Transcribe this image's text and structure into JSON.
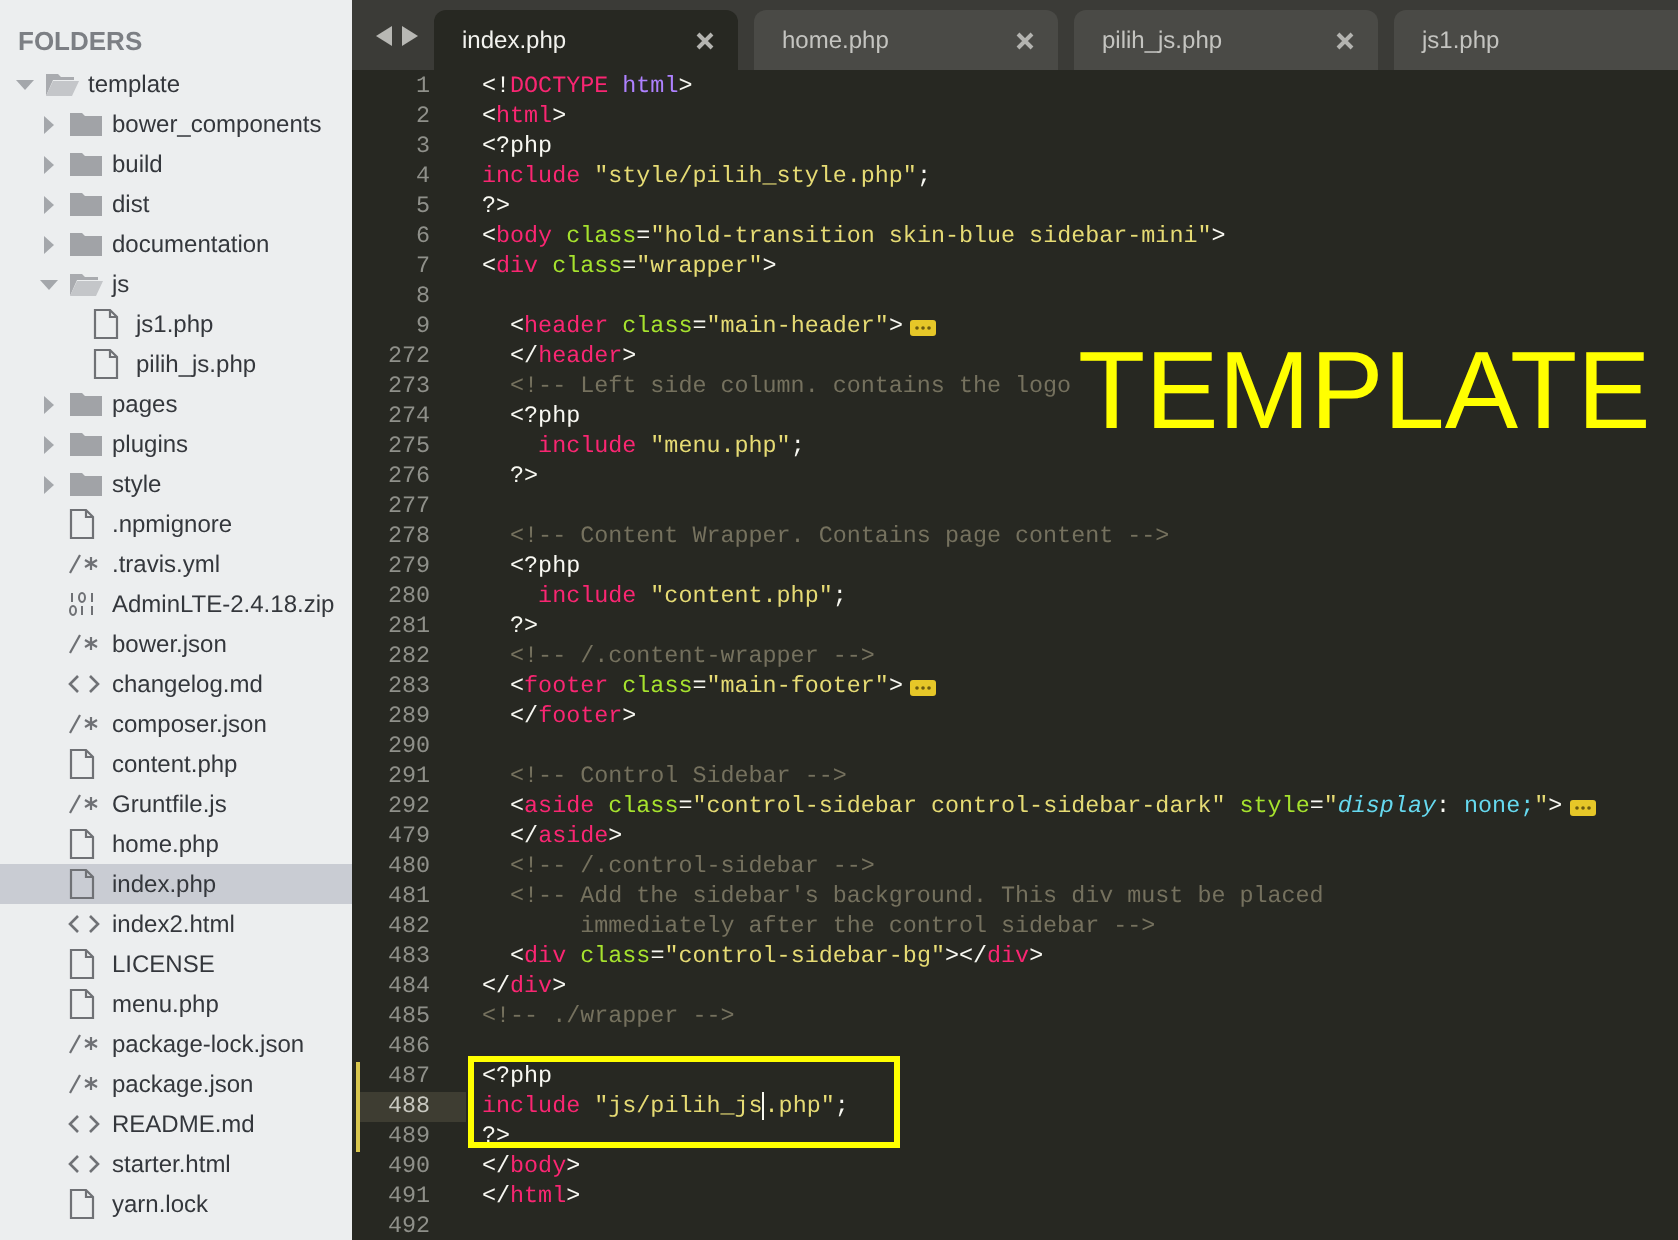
{
  "sidebar": {
    "title": "FOLDERS",
    "items": [
      {
        "name": "template",
        "kind": "folder",
        "expanded": true,
        "selected": false,
        "children": [
          {
            "name": "bower_components",
            "kind": "folder",
            "expanded": false,
            "selected": false
          },
          {
            "name": "build",
            "kind": "folder",
            "expanded": false,
            "selected": false
          },
          {
            "name": "dist",
            "kind": "folder",
            "expanded": false,
            "selected": false
          },
          {
            "name": "documentation",
            "kind": "folder",
            "expanded": false,
            "selected": false
          },
          {
            "name": "js",
            "kind": "folder",
            "expanded": true,
            "selected": false,
            "children": [
              {
                "name": "js1.php",
                "kind": "file",
                "selected": false
              },
              {
                "name": "pilih_js.php",
                "kind": "file",
                "selected": false
              }
            ]
          },
          {
            "name": "pages",
            "kind": "folder",
            "expanded": false,
            "selected": false
          },
          {
            "name": "plugins",
            "kind": "folder",
            "expanded": false,
            "selected": false
          },
          {
            "name": "style",
            "kind": "folder",
            "expanded": false,
            "selected": false
          },
          {
            "name": ".npmignore",
            "kind": "file",
            "selected": false
          },
          {
            "name": ".travis.yml",
            "kind": "comment",
            "selected": false
          },
          {
            "name": "AdminLTE-2.4.18.zip",
            "kind": "binary",
            "selected": false
          },
          {
            "name": "bower.json",
            "kind": "comment",
            "selected": false
          },
          {
            "name": "changelog.md",
            "kind": "code",
            "selected": false
          },
          {
            "name": "composer.json",
            "kind": "comment",
            "selected": false
          },
          {
            "name": "content.php",
            "kind": "file",
            "selected": false
          },
          {
            "name": "Gruntfile.js",
            "kind": "comment",
            "selected": false
          },
          {
            "name": "home.php",
            "kind": "file",
            "selected": false
          },
          {
            "name": "index.php",
            "kind": "file",
            "selected": true
          },
          {
            "name": "index2.html",
            "kind": "code",
            "selected": false
          },
          {
            "name": "LICENSE",
            "kind": "file",
            "selected": false
          },
          {
            "name": "menu.php",
            "kind": "file",
            "selected": false
          },
          {
            "name": "package-lock.json",
            "kind": "comment",
            "selected": false
          },
          {
            "name": "package.json",
            "kind": "comment",
            "selected": false
          },
          {
            "name": "README.md",
            "kind": "code",
            "selected": false
          },
          {
            "name": "starter.html",
            "kind": "code",
            "selected": false
          },
          {
            "name": "yarn.lock",
            "kind": "file",
            "selected": false
          }
        ]
      }
    ]
  },
  "tabs": [
    {
      "label": "index.php",
      "selected": true,
      "closable": true
    },
    {
      "label": "home.php",
      "selected": false,
      "closable": true
    },
    {
      "label": "pilih_js.php",
      "selected": false,
      "closable": true
    },
    {
      "label": "js1.php",
      "selected": false,
      "closable": false
    }
  ],
  "editor": {
    "annotation": "TEMPLATE",
    "lines": [
      {
        "number": "1",
        "current": false,
        "modified": false,
        "boxed": false,
        "folded": false,
        "tokens": [
          {
            "kind": "plain",
            "text": "<!"
          },
          {
            "kind": "tag",
            "text": "DOCTYPE"
          },
          {
            "kind": "constant",
            "text": " html"
          },
          {
            "kind": "plain",
            "text": ">"
          }
        ]
      },
      {
        "number": "2",
        "current": false,
        "modified": false,
        "boxed": false,
        "folded": false,
        "tokens": [
          {
            "kind": "plain",
            "text": "<"
          },
          {
            "kind": "tag",
            "text": "html"
          },
          {
            "kind": "plain",
            "text": ">"
          }
        ]
      },
      {
        "number": "3",
        "current": false,
        "modified": false,
        "boxed": false,
        "folded": false,
        "tokens": [
          {
            "kind": "plain",
            "text": "<?php"
          }
        ]
      },
      {
        "number": "4",
        "current": false,
        "modified": false,
        "boxed": false,
        "folded": false,
        "tokens": [
          {
            "kind": "keyword",
            "text": "include"
          },
          {
            "kind": "string",
            "text": " \"style/pilih_style.php\""
          },
          {
            "kind": "plain",
            "text": ";"
          }
        ]
      },
      {
        "number": "5",
        "current": false,
        "modified": false,
        "boxed": false,
        "folded": false,
        "tokens": [
          {
            "kind": "plain",
            "text": "?>"
          }
        ]
      },
      {
        "number": "6",
        "current": false,
        "modified": false,
        "boxed": false,
        "folded": false,
        "tokens": [
          {
            "kind": "plain",
            "text": "<"
          },
          {
            "kind": "tag",
            "text": "body"
          },
          {
            "kind": "attr",
            "text": " class"
          },
          {
            "kind": "plain",
            "text": "="
          },
          {
            "kind": "string",
            "text": "\"hold-transition skin-blue sidebar-mini\""
          },
          {
            "kind": "plain",
            "text": ">"
          }
        ]
      },
      {
        "number": "7",
        "current": false,
        "modified": false,
        "boxed": false,
        "folded": false,
        "tokens": [
          {
            "kind": "plain",
            "text": "<"
          },
          {
            "kind": "tag",
            "text": "div"
          },
          {
            "kind": "attr",
            "text": " class"
          },
          {
            "kind": "plain",
            "text": "="
          },
          {
            "kind": "string",
            "text": "\"wrapper\""
          },
          {
            "kind": "plain",
            "text": ">"
          }
        ]
      },
      {
        "number": "8",
        "current": false,
        "modified": false,
        "boxed": false,
        "folded": false
      },
      {
        "number": "9",
        "current": false,
        "modified": false,
        "boxed": false,
        "folded": true,
        "tokens": [
          {
            "kind": "plain",
            "text": "  <"
          },
          {
            "kind": "tag",
            "text": "header"
          },
          {
            "kind": "attr",
            "text": " class"
          },
          {
            "kind": "plain",
            "text": "="
          },
          {
            "kind": "string",
            "text": "\"main-header\""
          },
          {
            "kind": "plain",
            "text": ">"
          }
        ]
      },
      {
        "number": "272",
        "current": false,
        "modified": false,
        "boxed": false,
        "folded": false,
        "tokens": [
          {
            "kind": "plain",
            "text": "  </"
          },
          {
            "kind": "tag",
            "text": "header"
          },
          {
            "kind": "plain",
            "text": ">"
          }
        ]
      },
      {
        "number": "273",
        "current": false,
        "modified": false,
        "boxed": false,
        "folded": false,
        "tokens": [
          {
            "kind": "comment",
            "text": "  <!-- Left side column. contains the logo"
          }
        ]
      },
      {
        "number": "274",
        "current": false,
        "modified": false,
        "boxed": false,
        "folded": false,
        "tokens": [
          {
            "kind": "plain",
            "text": "  <?php"
          }
        ]
      },
      {
        "number": "275",
        "current": false,
        "modified": false,
        "boxed": false,
        "folded": false,
        "tokens": [
          {
            "kind": "keyword",
            "text": "    include"
          },
          {
            "kind": "string",
            "text": " \"menu.php\""
          },
          {
            "kind": "plain",
            "text": ";"
          }
        ]
      },
      {
        "number": "276",
        "current": false,
        "modified": false,
        "boxed": false,
        "folded": false,
        "tokens": [
          {
            "kind": "plain",
            "text": "  ?>"
          }
        ]
      },
      {
        "number": "277",
        "current": false,
        "modified": false,
        "boxed": false,
        "folded": false
      },
      {
        "number": "278",
        "current": false,
        "modified": false,
        "boxed": false,
        "folded": false,
        "tokens": [
          {
            "kind": "comment",
            "text": "  <!-- Content Wrapper. Contains page content -->"
          }
        ]
      },
      {
        "number": "279",
        "current": false,
        "modified": false,
        "boxed": false,
        "folded": false,
        "tokens": [
          {
            "kind": "plain",
            "text": "  <?php"
          }
        ]
      },
      {
        "number": "280",
        "current": false,
        "modified": false,
        "boxed": false,
        "folded": false,
        "tokens": [
          {
            "kind": "keyword",
            "text": "    include"
          },
          {
            "kind": "string",
            "text": " \"content.php\""
          },
          {
            "kind": "plain",
            "text": ";"
          }
        ]
      },
      {
        "number": "281",
        "current": false,
        "modified": false,
        "boxed": false,
        "folded": false,
        "tokens": [
          {
            "kind": "plain",
            "text": "  ?>"
          }
        ]
      },
      {
        "number": "282",
        "current": false,
        "modified": false,
        "boxed": false,
        "folded": false,
        "tokens": [
          {
            "kind": "comment",
            "text": "  <!-- /.content-wrapper -->"
          }
        ]
      },
      {
        "number": "283",
        "current": false,
        "modified": false,
        "boxed": false,
        "folded": true,
        "tokens": [
          {
            "kind": "plain",
            "text": "  <"
          },
          {
            "kind": "tag",
            "text": "footer"
          },
          {
            "kind": "attr",
            "text": " class"
          },
          {
            "kind": "plain",
            "text": "="
          },
          {
            "kind": "string",
            "text": "\"main-footer\""
          },
          {
            "kind": "plain",
            "text": ">"
          }
        ]
      },
      {
        "number": "289",
        "current": false,
        "modified": false,
        "boxed": false,
        "folded": false,
        "tokens": [
          {
            "kind": "plain",
            "text": "  </"
          },
          {
            "kind": "tag",
            "text": "footer"
          },
          {
            "kind": "plain",
            "text": ">"
          }
        ]
      },
      {
        "number": "290",
        "current": false,
        "modified": false,
        "boxed": false,
        "folded": false
      },
      {
        "number": "291",
        "current": false,
        "modified": false,
        "boxed": false,
        "folded": false,
        "tokens": [
          {
            "kind": "comment",
            "text": "  <!-- Control Sidebar -->"
          }
        ]
      },
      {
        "number": "292",
        "current": false,
        "modified": false,
        "boxed": false,
        "folded": true,
        "tokens": [
          {
            "kind": "plain",
            "text": "  <"
          },
          {
            "kind": "tag",
            "text": "aside"
          },
          {
            "kind": "attr",
            "text": " class"
          },
          {
            "kind": "plain",
            "text": "="
          },
          {
            "kind": "string",
            "text": "\"control-sidebar control-sidebar-dark\""
          },
          {
            "kind": "attr",
            "text": " style"
          },
          {
            "kind": "plain",
            "text": "="
          },
          {
            "kind": "string",
            "text": "\""
          },
          {
            "kind": "italic",
            "text": "display"
          },
          {
            "kind": "plain",
            "text": ":"
          },
          {
            "kind": "support",
            "text": " none;"
          },
          {
            "kind": "string",
            "text": "\""
          },
          {
            "kind": "plain",
            "text": ">"
          }
        ]
      },
      {
        "number": "479",
        "current": false,
        "modified": false,
        "boxed": false,
        "folded": false,
        "tokens": [
          {
            "kind": "plain",
            "text": "  </"
          },
          {
            "kind": "tag",
            "text": "aside"
          },
          {
            "kind": "plain",
            "text": ">"
          }
        ]
      },
      {
        "number": "480",
        "current": false,
        "modified": false,
        "boxed": false,
        "folded": false,
        "tokens": [
          {
            "kind": "comment",
            "text": "  <!-- /.control-sidebar -->"
          }
        ]
      },
      {
        "number": "481",
        "current": false,
        "modified": false,
        "boxed": false,
        "folded": false,
        "tokens": [
          {
            "kind": "comment",
            "text": "  <!-- Add the sidebar's background. This div must be placed"
          }
        ]
      },
      {
        "number": "482",
        "current": false,
        "modified": false,
        "boxed": false,
        "folded": false,
        "tokens": [
          {
            "kind": "comment",
            "text": "       immediately after the control sidebar -->"
          }
        ]
      },
      {
        "number": "483",
        "current": false,
        "modified": false,
        "boxed": false,
        "folded": false,
        "tokens": [
          {
            "kind": "plain",
            "text": "  <"
          },
          {
            "kind": "tag",
            "text": "div"
          },
          {
            "kind": "attr",
            "text": " class"
          },
          {
            "kind": "plain",
            "text": "="
          },
          {
            "kind": "string",
            "text": "\"control-sidebar-bg\""
          },
          {
            "kind": "plain",
            "text": "></"
          },
          {
            "kind": "tag",
            "text": "div"
          },
          {
            "kind": "plain",
            "text": ">"
          }
        ]
      },
      {
        "number": "484",
        "current": false,
        "modified": false,
        "boxed": false,
        "folded": false,
        "tokens": [
          {
            "kind": "plain",
            "text": "</"
          },
          {
            "kind": "tag",
            "text": "div"
          },
          {
            "kind": "plain",
            "text": ">"
          }
        ]
      },
      {
        "number": "485",
        "current": false,
        "modified": false,
        "boxed": false,
        "folded": false,
        "tokens": [
          {
            "kind": "comment",
            "text": "<!-- ./wrapper -->"
          }
        ]
      },
      {
        "number": "486",
        "current": false,
        "modified": false,
        "boxed": false,
        "folded": false
      },
      {
        "number": "487",
        "current": false,
        "modified": true,
        "boxed": true,
        "folded": false,
        "tokens": [
          {
            "kind": "plain",
            "text": "<?php"
          }
        ]
      },
      {
        "number": "488",
        "current": true,
        "modified": true,
        "boxed": true,
        "folded": false,
        "tokens": [
          {
            "kind": "keyword",
            "text": "include"
          },
          {
            "kind": "string",
            "text": " \"js/pilih_js"
          },
          {
            "kind": "cursor"
          },
          {
            "kind": "string",
            "text": ".php\""
          },
          {
            "kind": "plain",
            "text": ";"
          }
        ]
      },
      {
        "number": "489",
        "current": false,
        "modified": true,
        "boxed": true,
        "folded": false,
        "tokens": [
          {
            "kind": "plain",
            "text": "?>"
          }
        ]
      },
      {
        "number": "490",
        "current": false,
        "modified": false,
        "boxed": false,
        "folded": false,
        "tokens": [
          {
            "kind": "plain",
            "text": "</"
          },
          {
            "kind": "tag",
            "text": "body"
          },
          {
            "kind": "plain",
            "text": ">"
          }
        ]
      },
      {
        "number": "491",
        "current": false,
        "modified": false,
        "boxed": false,
        "folded": false,
        "tokens": [
          {
            "kind": "plain",
            "text": "</"
          },
          {
            "kind": "tag",
            "text": "html"
          },
          {
            "kind": "plain",
            "text": ">"
          }
        ]
      },
      {
        "number": "492",
        "current": false,
        "modified": false,
        "boxed": false,
        "folded": false
      }
    ]
  }
}
